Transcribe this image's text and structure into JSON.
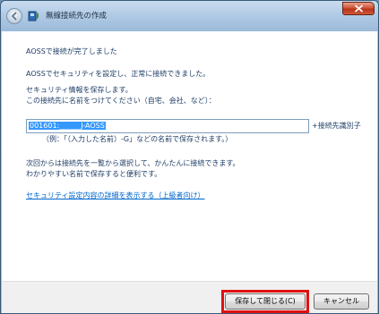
{
  "window": {
    "title": "無線接続先の作成"
  },
  "content": {
    "heading": "AOSSで接続が完了しました",
    "line_security": "AOSSでセキュリティを設定し、正常に接続できました。",
    "line_save": "セキュリティ情報を保存します。",
    "line_name_prompt": "この接続先に名前をつけてください（自宅、会社、など）：",
    "name_input_value": "001601:______J-AOSS",
    "identifier_label": "+接続先識別子",
    "example_text": "（例：「（入力した名前）-G」などの名前で保存されます。）",
    "next_time_line1": "次回からは接続先を一覧から選択して、かんたんに接続できます。",
    "next_time_line2": "わかりやすい名前で保存すると便利です。",
    "details_link": "セキュリティ設定内容の詳細を表示する（上級者向け）"
  },
  "footer": {
    "save_close_label": "保存して閉じる(C)",
    "cancel_label": "キャンセル"
  },
  "colors": {
    "text": "#1f3d66",
    "link": "#0066cc",
    "highlight": "#e01010",
    "selection": "#3399ff"
  }
}
